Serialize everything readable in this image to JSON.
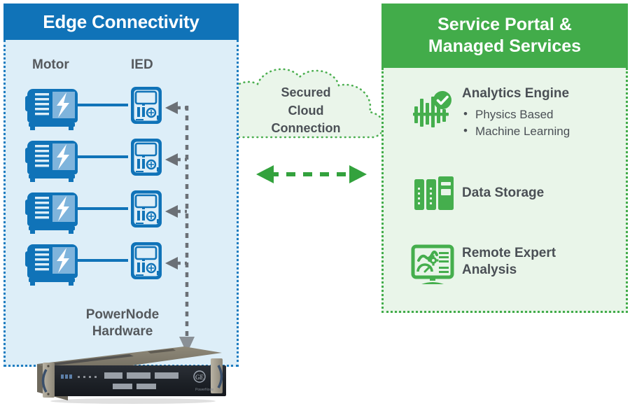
{
  "diagram": {
    "title_left": "Edge Connectivity",
    "title_right_line1": "Service Portal &",
    "title_right_line2": "Managed Services"
  },
  "left_panel": {
    "header": "Edge Connectivity",
    "column_labels": {
      "motor": "Motor",
      "ied": "IED"
    },
    "rows": [
      {
        "motor": "Motor",
        "ied": "IED"
      },
      {
        "motor": "Motor",
        "ied": "IED"
      },
      {
        "motor": "Motor",
        "ied": "IED"
      },
      {
        "motor": "Motor",
        "ied": "IED"
      }
    ],
    "hardware_label_line1": "PowerNode",
    "hardware_label_line2": "Hardware",
    "colors": {
      "header_bg": "#1073b8",
      "body_bg": "#ddeef8",
      "border": "#1d7cc0",
      "icon": "#1073b8",
      "arrow": "#6b7076"
    }
  },
  "cloud": {
    "line1": "Secured",
    "line2": "Cloud",
    "line3": "Connection",
    "colors": {
      "fill": "#eaf5ea",
      "border": "#4caf50",
      "arrow": "#33a23d"
    }
  },
  "right_panel": {
    "header_line1": "Service Portal &",
    "header_line2": "Managed Services",
    "services": [
      {
        "title": "Analytics Engine",
        "icon": "analytics-waveform-check-icon",
        "bullets": [
          "Physics Based",
          "Machine Learning"
        ]
      },
      {
        "title": "Data Storage",
        "icon": "server-rack-icon",
        "bullets": []
      },
      {
        "title": "Remote Expert Analysis",
        "title_line1": "Remote Expert",
        "title_line2": "Analysis",
        "icon": "monitor-analysis-icon",
        "bullets": []
      }
    ],
    "colors": {
      "header_bg": "#42ac4a",
      "body_bg": "#e9f5e9",
      "border": "#42ac4a",
      "icon": "#45ae4d",
      "text": "#4a4f55"
    }
  }
}
